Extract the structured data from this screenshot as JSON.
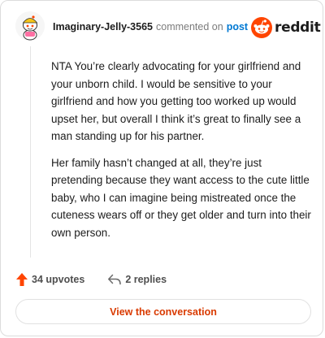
{
  "header": {
    "username": "Imaginary-Jelly-3565",
    "action_text": "commented on",
    "post_link": "post",
    "brand": "reddit"
  },
  "comment": {
    "paragraphs": [
      "NTA You’re clearly advocating for your girlfriend and your unborn child. I would be sensitive to your girlfriend and how you getting too worked up would upset her, but overall I think it’s great to finally see a man standing up for his partner.",
      "Her family hasn’t changed at all, they’re just pretending because they want access to the cute little baby, who I can imagine being mistreated once the cuteness wears off or they get older and turn into their own person."
    ]
  },
  "actions": {
    "upvotes": "34 upvotes",
    "replies": "2 replies"
  },
  "cta": {
    "label": "View the conversation"
  },
  "icons": {
    "avatar": "snoo-avatar",
    "logo": "reddit-snoo-icon",
    "upvote": "upvote-arrow-icon",
    "reply": "reply-arrow-icon"
  },
  "colors": {
    "brand_orange": "#ff4500",
    "link_blue": "#0079d3",
    "cta_text": "#d93a00"
  }
}
